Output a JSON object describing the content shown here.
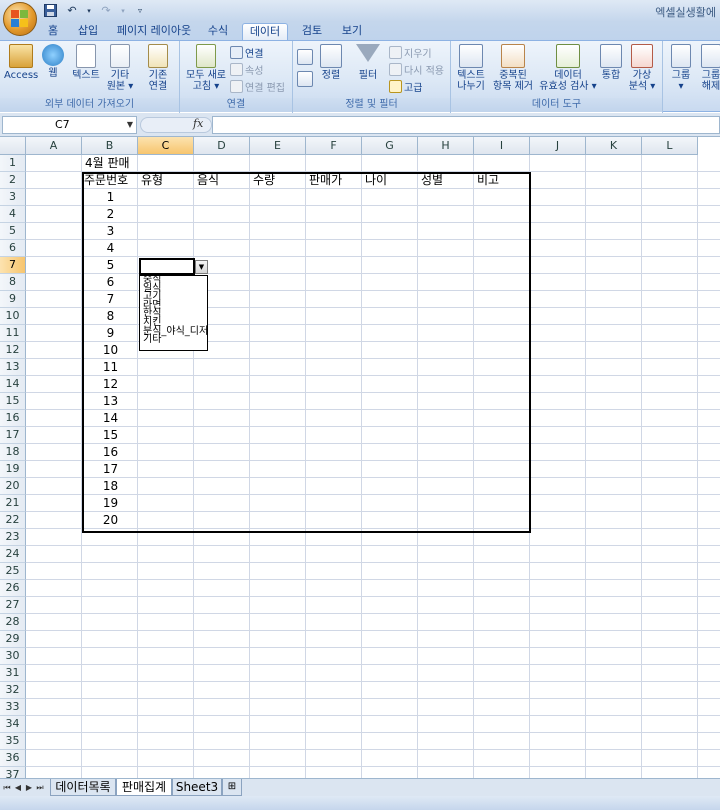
{
  "app": {
    "window_title": "엑셀실생활에"
  },
  "tabs": [
    "홈",
    "삽입",
    "페이지 레이아웃",
    "수식",
    "데이터",
    "검토",
    "보기"
  ],
  "active_tab": "데이터",
  "ribbon": {
    "groups": [
      {
        "label": "외부 데이터 가져오기"
      },
      {
        "label": "연결"
      },
      {
        "label": "정렬 및 필터"
      },
      {
        "label": "데이터 도구"
      }
    ],
    "ext": {
      "access": "Access",
      "web": "웹",
      "text": "텍스트",
      "other_1": "기타",
      "other_2": "원본 ▾",
      "existing_1": "기존",
      "existing_2": "연결"
    },
    "conn": {
      "refresh_1": "모두 새로",
      "refresh_2": "고침 ▾",
      "connections": "연결",
      "properties": "속성",
      "edit_links": "연결 편집"
    },
    "sort": {
      "sort": "정렬",
      "filter": "필터",
      "clear": "지우기",
      "reapply": "다시 적용",
      "advanced": "고급"
    },
    "tools": {
      "text_to_col_1": "텍스트",
      "text_to_col_2": "나누기",
      "dedupe_1": "중복된",
      "dedupe_2": "항목 제거",
      "validation_1": "데이터",
      "validation_2": "유효성 검사 ▾",
      "consolidate": "통합",
      "whatif_1": "가상",
      "whatif_2": "분석 ▾"
    },
    "outline": {
      "group_1": "그룹",
      "group_2": "▾",
      "ungroup_1": "그룹",
      "ungroup_2": "해제"
    }
  },
  "formula_bar": {
    "name_box": "C7",
    "fx": "fx",
    "formula": ""
  },
  "columns": [
    "A",
    "B",
    "C",
    "D",
    "E",
    "F",
    "G",
    "H",
    "I",
    "J",
    "K",
    "L"
  ],
  "selected_column": "C",
  "selected_row": "7",
  "sheet": {
    "title": "4월 판매",
    "headers": [
      "주문번호",
      "유형",
      "음식",
      "수량",
      "판매가",
      "나이",
      "성별",
      "비고"
    ],
    "order_numbers": [
      "1",
      "2",
      "3",
      "4",
      "5",
      "6",
      "7",
      "8",
      "9",
      "10",
      "11",
      "12",
      "13",
      "14",
      "15",
      "16",
      "17",
      "18",
      "19",
      "20"
    ]
  },
  "dropdown": {
    "options": [
      "중식",
      "일식",
      "고기",
      "라면",
      "한식",
      "치킨",
      "분식_야식_디저트",
      "기타"
    ]
  },
  "sheet_tabs": [
    "데이터목록",
    "판매집계",
    "Sheet3"
  ],
  "active_sheet": "판매집계"
}
